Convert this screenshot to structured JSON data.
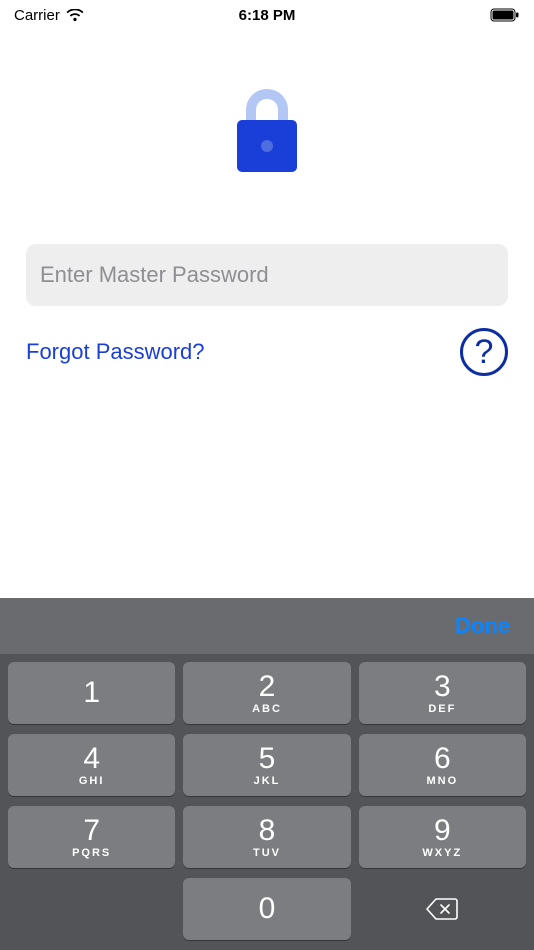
{
  "status_bar": {
    "carrier": "Carrier",
    "time": "6:18 PM"
  },
  "password_input": {
    "value": "",
    "placeholder": "Enter Master Password"
  },
  "forgot_link": "Forgot Password?",
  "help_label": "?",
  "keyboard": {
    "done_label": "Done",
    "keys": [
      [
        {
          "digit": "1",
          "letters": ""
        },
        {
          "digit": "2",
          "letters": "ABC"
        },
        {
          "digit": "3",
          "letters": "DEF"
        }
      ],
      [
        {
          "digit": "4",
          "letters": "GHI"
        },
        {
          "digit": "5",
          "letters": "JKL"
        },
        {
          "digit": "6",
          "letters": "MNO"
        }
      ],
      [
        {
          "digit": "7",
          "letters": "PQRS"
        },
        {
          "digit": "8",
          "letters": "TUV"
        },
        {
          "digit": "9",
          "letters": "WXYZ"
        }
      ],
      [
        {
          "digit": "",
          "letters": "",
          "blank": true
        },
        {
          "digit": "0",
          "letters": ""
        },
        {
          "digit": "",
          "letters": "",
          "backspace": true
        }
      ]
    ]
  }
}
